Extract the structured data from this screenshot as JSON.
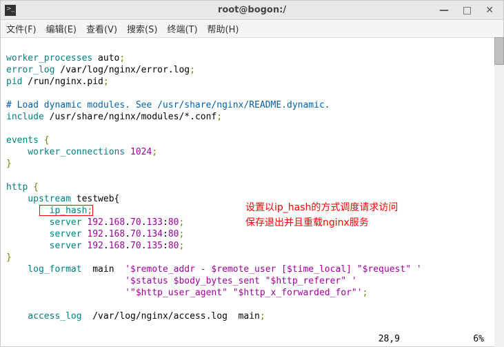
{
  "window": {
    "title": "root@bogon:/",
    "controls": {
      "min": "—",
      "max": "□",
      "close": "✕"
    }
  },
  "menu": {
    "file": "文件(F)",
    "edit": "编辑(E)",
    "view": "查看(V)",
    "search": "搜索(S)",
    "terminal": "终端(T)",
    "help": "帮助(H)"
  },
  "code": {
    "l1a": "worker_processes",
    "l1b": " auto",
    "l2a": "error_log",
    "l2b": " /var/log/nginx/error.log",
    "l3a": "pid",
    "l3b": " /run/nginx.pid",
    "l5": "# Load dynamic modules. See /usr/share/nginx/README.dynamic.",
    "l6a": "include",
    "l6b": " /usr/share/nginx/modules/*.conf",
    "l8a": "events",
    "l8b": " {",
    "l9a": "    worker_connections",
    "l9b": " ",
    "l9c": "1024",
    "l10": "}",
    "l12a": "http",
    "l12b": " {",
    "l13a": "    upstream",
    "l13b": " testweb{",
    "l14a": "        ip_hash",
    "l15a": "        server",
    "l15b": " ",
    "l15c": "192",
    "l15d": ".",
    "l15e": "168",
    "l15f": ".",
    "l15g": "70",
    "l15h": ".",
    "l15i": "133",
    "l15j": ":",
    "l15k": "80",
    "l16a": "        server",
    "l16b": " ",
    "l16c": "192",
    "l16d": ".",
    "l16e": "168",
    "l16f": ".",
    "l16g": "70",
    "l16h": ".",
    "l16i": "134",
    "l16j": ":",
    "l16k": "80",
    "l17a": "        server",
    "l17b": " ",
    "l17c": "192",
    "l17d": ".",
    "l17e": "168",
    "l17f": ".",
    "l17g": "70",
    "l17h": ".",
    "l17i": "135",
    "l17j": ":",
    "l17k": "80",
    "l18": "}",
    "l19a": "    log_format",
    "l19b": "  main  ",
    "l19c": "'$remote_addr - $remote_user [$time_local] \"$request\" '",
    "l20a": "                      ",
    "l20b": "'$status $body_bytes_sent \"$http_referer\" '",
    "l21a": "                      ",
    "l21b": "'\"$http_user_agent\" \"$http_x_forwarded_for\"'",
    "l23a": "    access_log",
    "l23b": "  /var/log/nginx/access.log  main",
    "semi": ";"
  },
  "annotation": {
    "line1": "设置以ip_hash的方式调度请求访问",
    "line2": "保存退出并且重载nginx服务"
  },
  "status": {
    "pos": "28,9",
    "pct": "6%"
  }
}
